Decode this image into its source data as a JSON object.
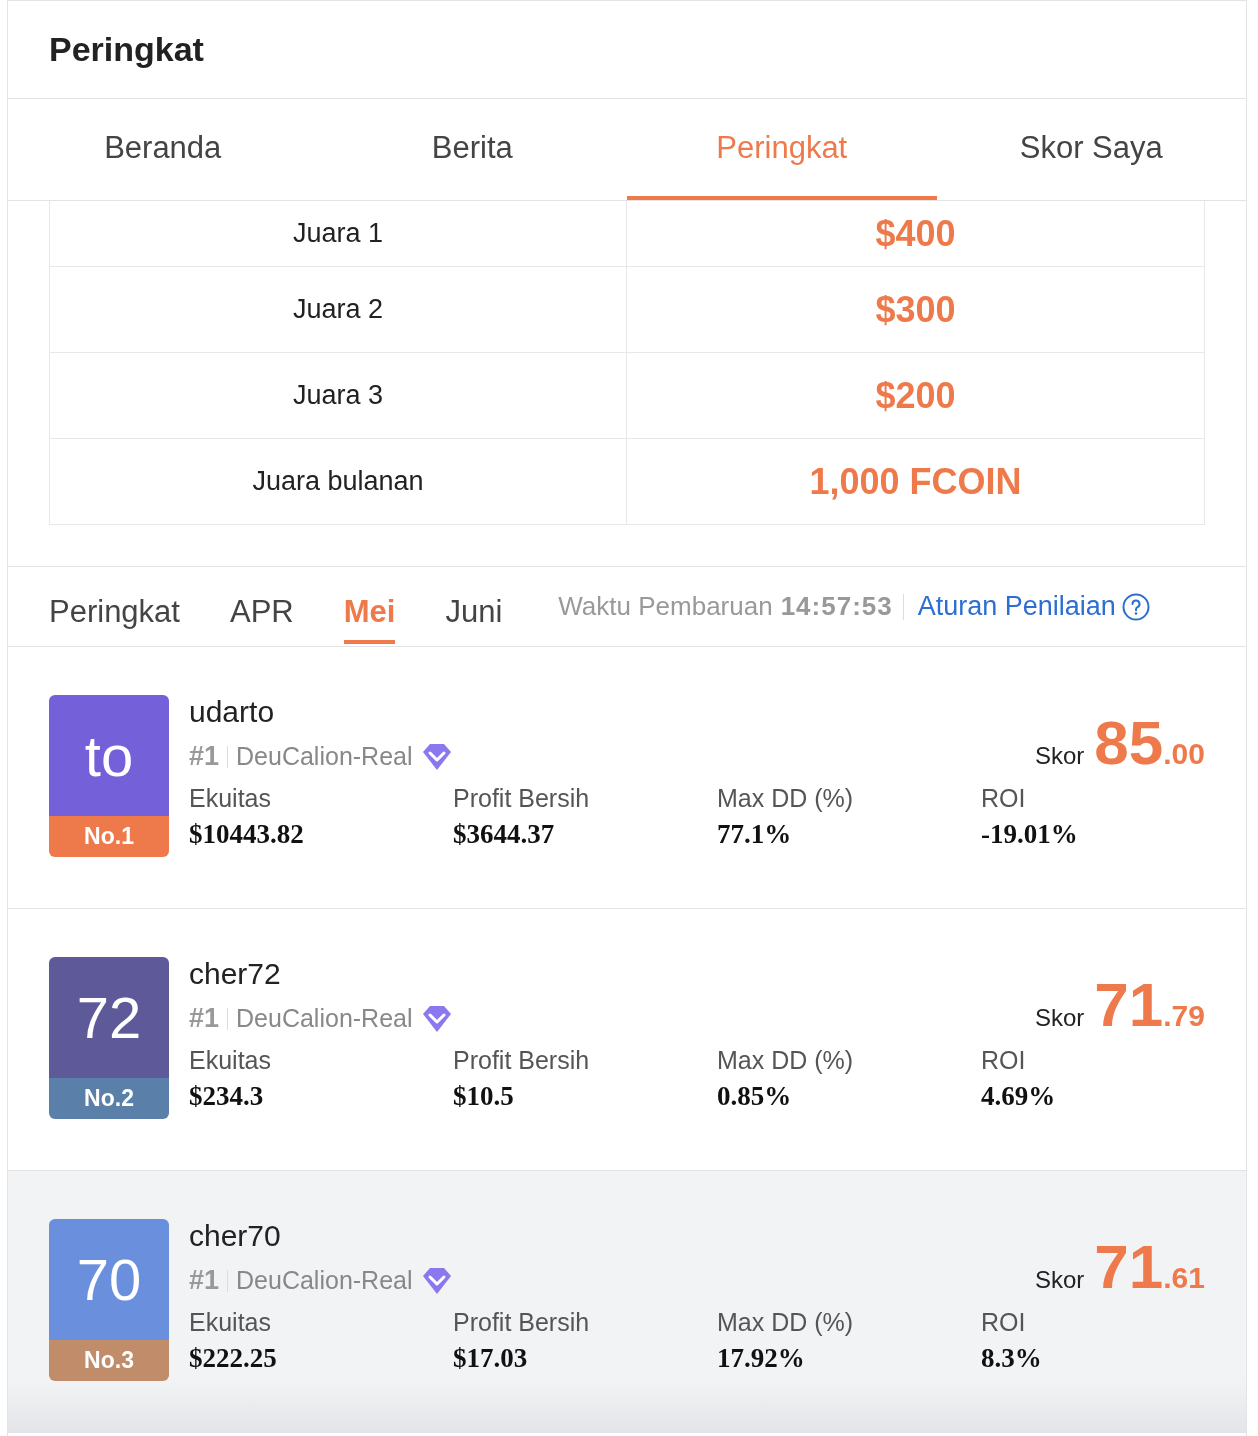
{
  "header": {
    "title": "Peringkat"
  },
  "tabs": [
    {
      "label": "Beranda",
      "selected": false
    },
    {
      "label": "Berita",
      "selected": false
    },
    {
      "label": "Peringkat",
      "selected": true
    },
    {
      "label": "Skor Saya",
      "selected": false
    }
  ],
  "prizes": [
    {
      "label": "Juara 1",
      "value": "$400"
    },
    {
      "label": "Juara 2",
      "value": "$300"
    },
    {
      "label": "Juara 3",
      "value": "$200"
    },
    {
      "label": "Juara bulanan",
      "value": "1,000 FCOIN"
    }
  ],
  "period_tabs": [
    {
      "label": "Peringkat",
      "selected": false
    },
    {
      "label": "APR",
      "selected": false
    },
    {
      "label": "Mei",
      "selected": true
    },
    {
      "label": "Juni",
      "selected": false
    }
  ],
  "update_label": "Waktu Pembaruan",
  "update_time": "14:57:53",
  "rules_link": "Aturan Penilaian",
  "leaders": [
    {
      "avatar": "to",
      "rank_badge": "No.1",
      "color": "#7460d9",
      "kind": "gold",
      "name": "udarto",
      "rank": "#1",
      "account": "DeuCalion-Real",
      "score_label": "Skor",
      "score_int": "85",
      "score_dec": ".00",
      "selected": false,
      "stats": [
        {
          "label": "Ekuitas",
          "value": "$10443.82"
        },
        {
          "label": "Profit Bersih",
          "value": "$3644.37"
        },
        {
          "label": "Max DD (%)",
          "value": "77.1%"
        },
        {
          "label": "ROI",
          "value": "-19.01%"
        }
      ]
    },
    {
      "avatar": "72",
      "rank_badge": "No.2",
      "color": "#5e5a9a",
      "kind": "silver",
      "name": "cher72",
      "rank": "#1",
      "account": "DeuCalion-Real",
      "score_label": "Skor",
      "score_int": "71",
      "score_dec": ".79",
      "selected": false,
      "stats": [
        {
          "label": "Ekuitas",
          "value": "$234.3"
        },
        {
          "label": "Profit Bersih",
          "value": "$10.5"
        },
        {
          "label": "Max DD (%)",
          "value": "0.85%"
        },
        {
          "label": "ROI",
          "value": "4.69%"
        }
      ]
    },
    {
      "avatar": "70",
      "rank_badge": "No.3",
      "color": "#6a8fdd",
      "kind": "bronze",
      "name": "cher70",
      "rank": "#1",
      "account": "DeuCalion-Real",
      "score_label": "Skor",
      "score_int": "71",
      "score_dec": ".61",
      "selected": true,
      "stats": [
        {
          "label": "Ekuitas",
          "value": "$222.25"
        },
        {
          "label": "Profit Bersih",
          "value": "$17.03"
        },
        {
          "label": "Max DD (%)",
          "value": "17.92%"
        },
        {
          "label": "ROI",
          "value": "8.3%"
        }
      ]
    }
  ]
}
